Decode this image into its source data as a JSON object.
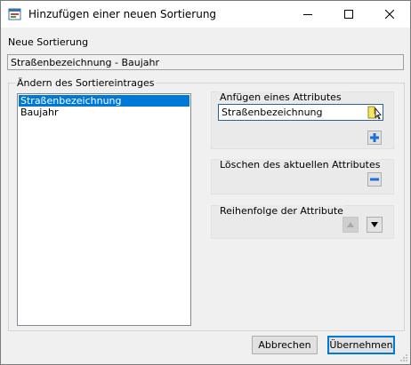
{
  "window": {
    "title": "Hinzufügen einer neuen Sortierung",
    "icons": {
      "app": "sort-app-icon",
      "minimize": "minimize-icon",
      "maximize": "maximize-icon",
      "close": "close-icon"
    }
  },
  "sort_name": {
    "label": "Neue Sortierung",
    "value": "Straßenbezeichnung - Baujahr"
  },
  "edit_group": {
    "title": "Ändern des Sortiereintrages",
    "entries": [
      "Straßenbezeichnung",
      "Baujahr"
    ],
    "selected_index": 0
  },
  "append_attribute": {
    "title": "Anfügen eines Attributes",
    "value": "Straßenbezeichnung",
    "picker_icon": "hand-pointer-icon",
    "add_icon": "plus-icon"
  },
  "delete_attribute": {
    "title": "Löschen des aktuellen Attributes",
    "icon": "minus-icon"
  },
  "order": {
    "title": "Reihenfolge der Attribute",
    "up_icon": "move-up-icon",
    "down_icon": "move-down-icon"
  },
  "buttons": {
    "cancel": "Abbrechen",
    "ok": "Übernehmen"
  },
  "colors": {
    "selection": "#0078d7",
    "add_icon": "#1e6fd9",
    "window_bg": "#f0f0f0"
  }
}
